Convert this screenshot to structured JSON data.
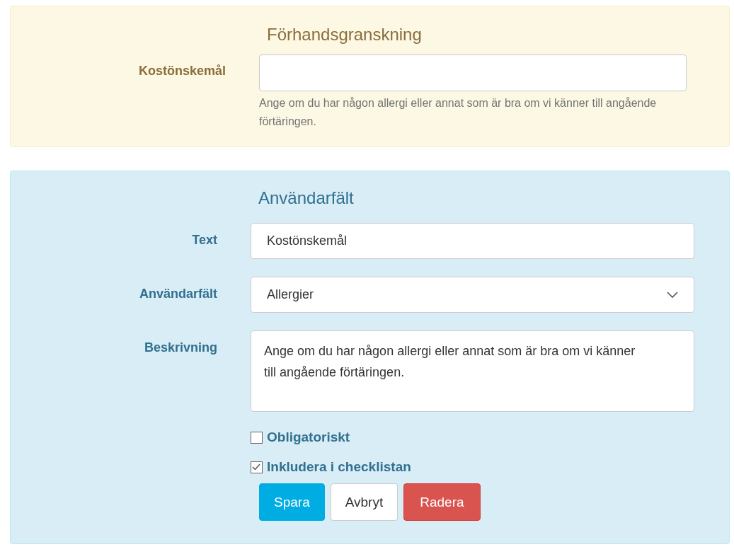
{
  "preview": {
    "title": "Förhandsgranskning",
    "label": "Kostönskemål",
    "help": "Ange om du har någon allergi eller annat som är bra om vi känner till angående förtäringen."
  },
  "editor": {
    "title": "Användarfält",
    "fields": [
      {
        "kind": "text",
        "label": "Text",
        "value": "Kostönskemål"
      },
      {
        "kind": "select",
        "label": "Användarfält",
        "value": "Allergier"
      },
      {
        "kind": "textarea",
        "label": "Beskrivning",
        "value": "Ange om du har någon allergi eller annat som är bra om vi känner till angående förtäringen."
      }
    ],
    "checkboxes": [
      {
        "label": "Obligatoriskt",
        "checked": false
      },
      {
        "label": "Inkludera i checklistan",
        "checked": true
      }
    ],
    "buttons": [
      {
        "kind": "primary",
        "label": "Spara"
      },
      {
        "kind": "default",
        "label": "Avbryt"
      },
      {
        "kind": "danger",
        "label": "Radera"
      }
    ]
  }
}
